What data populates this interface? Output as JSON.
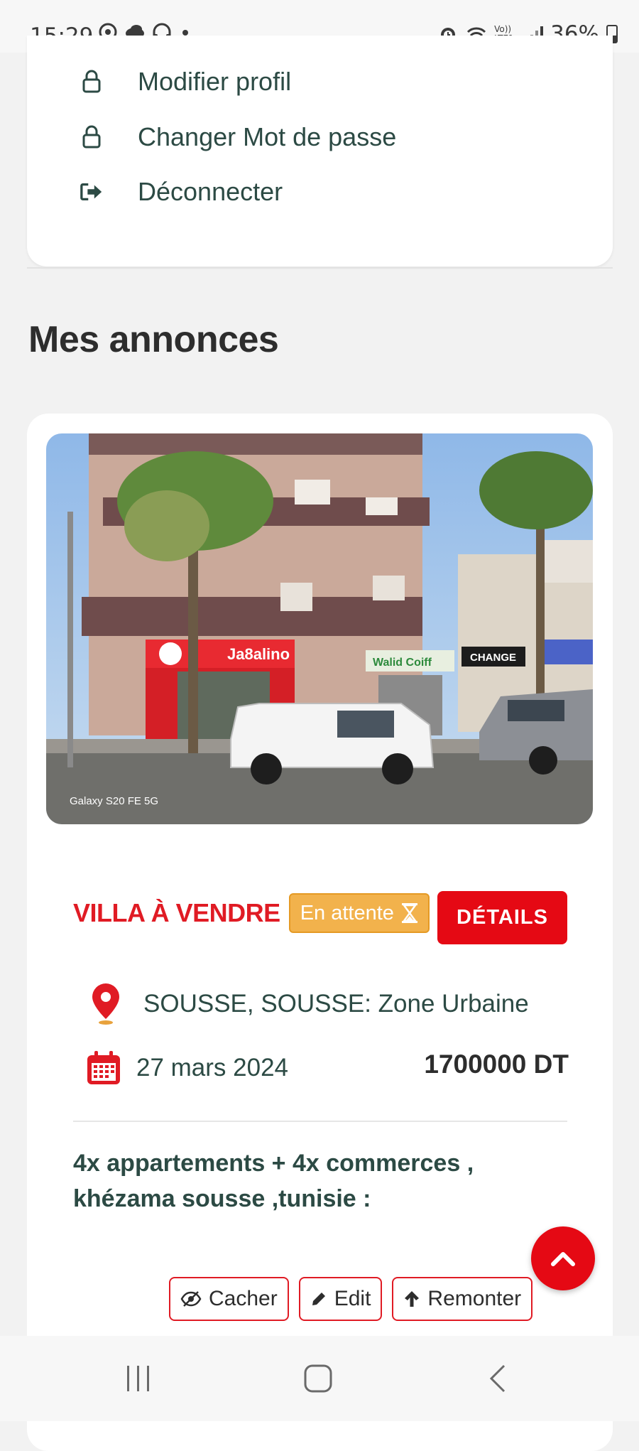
{
  "status_bar": {
    "time": "15:29",
    "network_label": "Vo)) LTE1",
    "battery": "36%"
  },
  "menu": {
    "items": [
      {
        "label": "Modifier profil",
        "icon": "lock-icon"
      },
      {
        "label": "Changer Mot de passe",
        "icon": "lock-icon"
      },
      {
        "label": "Déconnecter",
        "icon": "sign-out-icon"
      }
    ]
  },
  "section_title": "Mes annonces",
  "listing": {
    "photo_watermark": "Galaxy S20 FE 5G",
    "photo_sign_1": "Ja8alino",
    "photo_sign_2": "Walid Coiff",
    "photo_sign_3": "CHANGE",
    "title": "VILLA À VENDRE",
    "status_badge": "En attente",
    "details_label": "DÉTAILS",
    "location": "SOUSSE, SOUSSE: Zone Urbaine",
    "date": "27 mars 2024",
    "price": "1700000 DT",
    "description": "4x appartements + 4x commerces , khézama sousse ,tunisie :",
    "actions": {
      "hide_label": "Cacher",
      "edit_label": "Edit",
      "bump_label": "Remonter"
    }
  },
  "colors": {
    "accent_red": "#e50914",
    "title_red": "#e01b24",
    "badge_orange": "#f2b24c",
    "text_dark_teal": "#2c4a44"
  }
}
